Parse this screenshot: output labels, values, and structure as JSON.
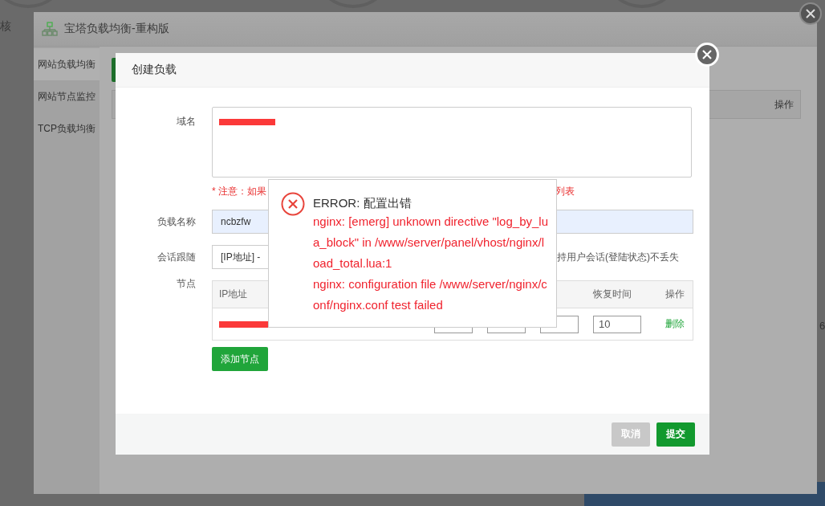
{
  "background": {
    "side_text": "核",
    "edge_text": "6"
  },
  "plugin_window": {
    "title": "宝塔负载均衡-重构版",
    "sidebar": [
      {
        "label": "网站负载均衡",
        "selected": true
      },
      {
        "label": "网站节点监控",
        "selected": false
      },
      {
        "label": "TCP负载均衡",
        "selected": false
      }
    ],
    "table_header_last": "操作"
  },
  "dialog": {
    "title": "创建负载",
    "domain_label": "域名",
    "note_start": "* 注意：如果",
    "note_end": "列表",
    "name_label": "负载名称",
    "name_value": "ncbzfw",
    "session_label": "会话跟随",
    "session_value": "[IP地址] - ",
    "session_hint": "持用户会话(登陆状态)不丢失",
    "nodes_label": "节点",
    "node_headers": {
      "ip": "IP地址",
      "recover_time": "恢复时间",
      "action": "操作"
    },
    "node_rows": [
      {
        "recover_time": "10",
        "action": "删除"
      }
    ],
    "add_node": "添加节点",
    "buttons": [
      {
        "label": "取消",
        "kind": "cancel"
      },
      {
        "label": "提交",
        "kind": "submit"
      }
    ]
  },
  "error": {
    "title": "ERROR: 配置出错",
    "messages": [
      "nginx: [emerg] unknown directive \"log_by_lua_block\" in /www/server/panel/vhost/nginx/load_total.lua:1",
      "nginx: configuration file /www/server/nginx/conf/nginx.conf test failed"
    ]
  }
}
